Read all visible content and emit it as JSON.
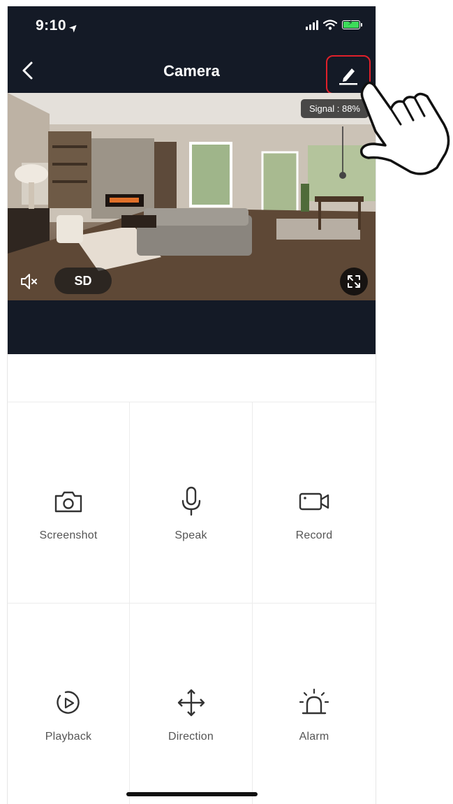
{
  "status_bar": {
    "time": "9:10",
    "location_glyph": "➤"
  },
  "nav": {
    "title": "Camera",
    "back_icon": "chevron-left-icon",
    "edit_icon": "pencil-icon"
  },
  "video": {
    "signal_label": "Signal : 88%",
    "quality_label": "SD",
    "mute_icon": "speaker-mute-icon",
    "fullscreen_icon": "fullscreen-icon"
  },
  "actions": [
    {
      "label": "Screenshot",
      "icon": "camera-icon"
    },
    {
      "label": "Speak",
      "icon": "microphone-icon"
    },
    {
      "label": "Record",
      "icon": "video-camera-icon"
    },
    {
      "label": "Playback",
      "icon": "playback-icon"
    },
    {
      "label": "Direction",
      "icon": "move-arrows-icon"
    },
    {
      "label": "Alarm",
      "icon": "siren-icon"
    }
  ],
  "colors": {
    "header_bg": "#141a26",
    "highlight": "#e0202a",
    "battery": "#3ddc5a",
    "icon": "#333333",
    "label": "#555555"
  }
}
